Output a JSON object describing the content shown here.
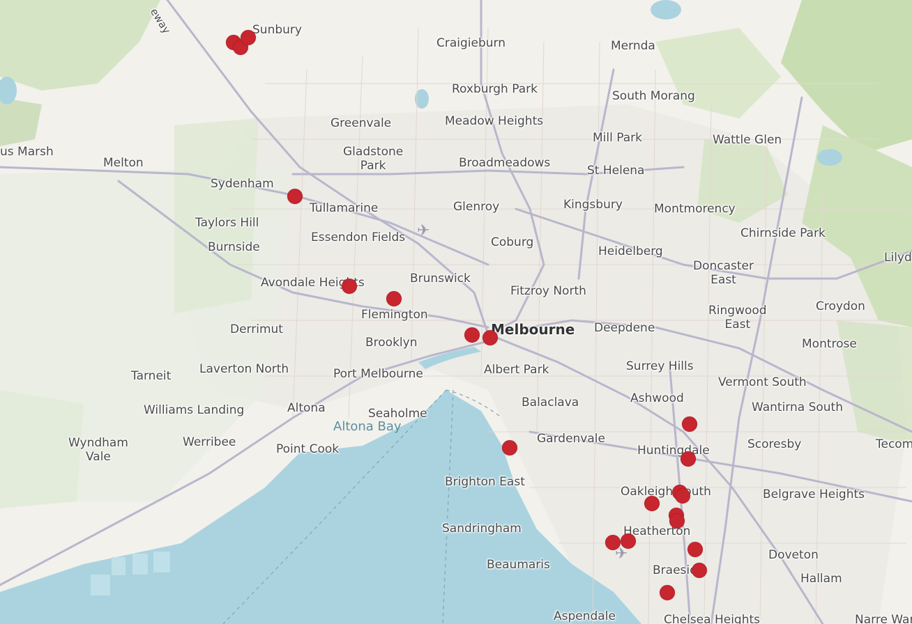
{
  "map": {
    "labels": [
      {
        "id": "sunbury",
        "text": "Sunbury"
      },
      {
        "id": "craigieburn",
        "text": "Craigieburn"
      },
      {
        "id": "mernda",
        "text": "Mernda"
      },
      {
        "id": "roxburgh-park",
        "text": "Roxburgh Park"
      },
      {
        "id": "south-morang",
        "text": "South Morang"
      },
      {
        "id": "greenvale",
        "text": "Greenvale"
      },
      {
        "id": "meadow-heights",
        "text": "Meadow Heights"
      },
      {
        "id": "mill-park",
        "text": "Mill Park"
      },
      {
        "id": "wattle-glen",
        "text": "Wattle Glen"
      },
      {
        "id": "gladstone-park",
        "text": "Gladstone\nPark"
      },
      {
        "id": "broadmeadows",
        "text": "Broadmeadows"
      },
      {
        "id": "st-helena",
        "text": "St Helena"
      },
      {
        "id": "melton",
        "text": "Melton"
      },
      {
        "id": "us-marsh",
        "text": "us Marsh"
      },
      {
        "id": "sydenham",
        "text": "Sydenham"
      },
      {
        "id": "tullamarine",
        "text": "Tullamarine"
      },
      {
        "id": "glenroy",
        "text": "Glenroy"
      },
      {
        "id": "kingsbury",
        "text": "Kingsbury"
      },
      {
        "id": "montmorency",
        "text": "Montmorency"
      },
      {
        "id": "chirnside-park",
        "text": "Chirnside Park"
      },
      {
        "id": "lilyd",
        "text": "Lilyd"
      },
      {
        "id": "taylors-hill",
        "text": "Taylors Hill"
      },
      {
        "id": "essendon-fields",
        "text": "Essendon Fields"
      },
      {
        "id": "coburg",
        "text": "Coburg"
      },
      {
        "id": "heidelberg",
        "text": "Heidelberg"
      },
      {
        "id": "burnside",
        "text": "Burnside"
      },
      {
        "id": "doncaster-east",
        "text": "Doncaster\nEast"
      },
      {
        "id": "avondale-heights",
        "text": "Avondale Heights"
      },
      {
        "id": "brunswick",
        "text": "Brunswick"
      },
      {
        "id": "fitzroy-north",
        "text": "Fitzroy North"
      },
      {
        "id": "ringwood-east",
        "text": "Ringwood\nEast"
      },
      {
        "id": "croydon",
        "text": "Croydon"
      },
      {
        "id": "flemington",
        "text": "Flemington"
      },
      {
        "id": "derrimut",
        "text": "Derrimut"
      },
      {
        "id": "melbourne",
        "text": "Melbourne"
      },
      {
        "id": "deepdene",
        "text": "Deepdene"
      },
      {
        "id": "brooklyn",
        "text": "Brooklyn"
      },
      {
        "id": "montrose",
        "text": "Montrose"
      },
      {
        "id": "tarneit",
        "text": "Tarneit"
      },
      {
        "id": "laverton-north",
        "text": "Laverton North"
      },
      {
        "id": "port-melbourne",
        "text": "Port Melbourne"
      },
      {
        "id": "albert-park",
        "text": "Albert Park"
      },
      {
        "id": "surrey-hills",
        "text": "Surrey Hills"
      },
      {
        "id": "vermont-south",
        "text": "Vermont South"
      },
      {
        "id": "balaclava",
        "text": "Balaclava"
      },
      {
        "id": "ashwood",
        "text": "Ashwood"
      },
      {
        "id": "wantirna-south",
        "text": "Wantirna South"
      },
      {
        "id": "williams-landing",
        "text": "Williams Landing"
      },
      {
        "id": "altona",
        "text": "Altona"
      },
      {
        "id": "seaholme",
        "text": "Seaholme"
      },
      {
        "id": "altona-bay",
        "text": "Altona Bay"
      },
      {
        "id": "wyndham-vale",
        "text": "Wyndham\nVale"
      },
      {
        "id": "werribee",
        "text": "Werribee"
      },
      {
        "id": "point-cook",
        "text": "Point Cook"
      },
      {
        "id": "gardenvale",
        "text": "Gardenvale"
      },
      {
        "id": "huntingdale",
        "text": "Huntingdale"
      },
      {
        "id": "scoresby",
        "text": "Scoresby"
      },
      {
        "id": "tecom",
        "text": "Tecom"
      },
      {
        "id": "brighton-east",
        "text": "Brighton East"
      },
      {
        "id": "oakleigh-south",
        "text": "Oakleigh South"
      },
      {
        "id": "belgrave-heights",
        "text": "Belgrave Heights"
      },
      {
        "id": "sandringham",
        "text": "Sandringham"
      },
      {
        "id": "heatherton",
        "text": "Heatherton"
      },
      {
        "id": "doveton",
        "text": "Doveton"
      },
      {
        "id": "beaumaris",
        "text": "Beaumaris"
      },
      {
        "id": "braeside",
        "text": "Braeside"
      },
      {
        "id": "hallam",
        "text": "Hallam"
      },
      {
        "id": "aspendale",
        "text": "Aspendale"
      },
      {
        "id": "chelsea-heights",
        "text": "Chelsea Heights"
      },
      {
        "id": "narre-warren",
        "text": "Narre Warre"
      },
      {
        "id": "freeway",
        "text": "eway"
      }
    ],
    "markers_count": 24,
    "colors": {
      "marker": "#c8262f",
      "water": "#aad3df",
      "land": "#f4f3ef",
      "forest": "#c8dcb0",
      "road": "#b5b3c8"
    }
  }
}
